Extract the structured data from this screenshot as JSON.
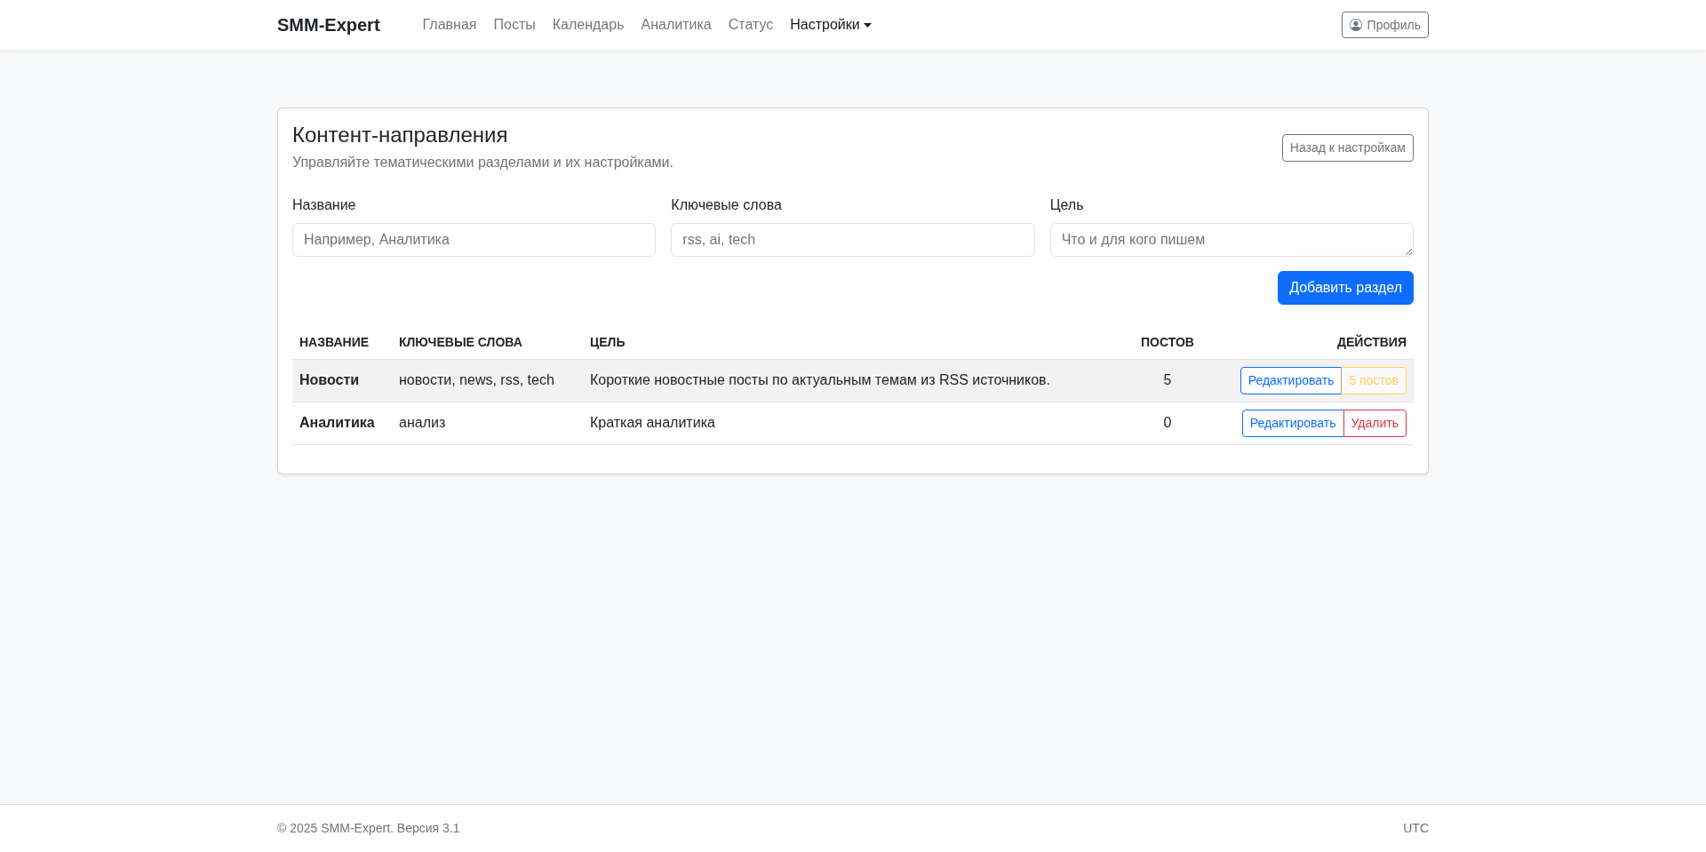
{
  "navbar": {
    "brand": "SMM-Expert",
    "items": [
      {
        "label": "Главная",
        "selected": false,
        "dropdown": false
      },
      {
        "label": "Посты",
        "selected": false,
        "dropdown": false
      },
      {
        "label": "Календарь",
        "selected": false,
        "dropdown": false
      },
      {
        "label": "Аналитика",
        "selected": false,
        "dropdown": false
      },
      {
        "label": "Статус",
        "selected": false,
        "dropdown": false
      },
      {
        "label": "Настройки",
        "selected": true,
        "dropdown": true
      }
    ],
    "profile_button": "Профиль"
  },
  "card": {
    "title": "Контент-направления",
    "subtitle": "Управляйте тематическими разделами и их настройками.",
    "back_button": "Назад к настройкам",
    "fields": [
      {
        "label": "Название",
        "placeholder": "Например, Аналитика",
        "kind": "input"
      },
      {
        "label": "Ключевые слова",
        "placeholder": "rss, ai, tech",
        "kind": "input"
      },
      {
        "label": "Цель",
        "placeholder": "Что и для кого пишем",
        "kind": "textarea"
      }
    ],
    "submit_button": "Добавить раздел",
    "table": {
      "columns": [
        "НАЗВАНИЕ",
        "КЛЮЧЕВЫЕ СЛОВА",
        "ЦЕЛЬ",
        "ПОСТОВ",
        "ДЕЙСТВИЯ"
      ],
      "rows": [
        {
          "highlighted": true,
          "name": "Новости",
          "keywords": "новости, news, rss, tech",
          "goal": "Короткие новостные посты по актуальным темам из RSS источников.",
          "posts": "5",
          "actions": [
            {
              "label": "Редактировать",
              "kind": "edit",
              "disabled": false
            },
            {
              "label": "5 постов",
              "kind": "posts",
              "disabled": true
            }
          ]
        },
        {
          "highlighted": false,
          "name": "Аналитика",
          "keywords": "анализ",
          "goal": "Краткая аналитика",
          "posts": "0",
          "actions": [
            {
              "label": "Редактировать",
              "kind": "edit",
              "disabled": false
            },
            {
              "label": "Удалить",
              "kind": "delete",
              "disabled": false
            }
          ]
        }
      ]
    }
  },
  "footer": {
    "copyright": "© 2025 SMM-Expert. Версия 3.1",
    "timezone": "UTC"
  }
}
